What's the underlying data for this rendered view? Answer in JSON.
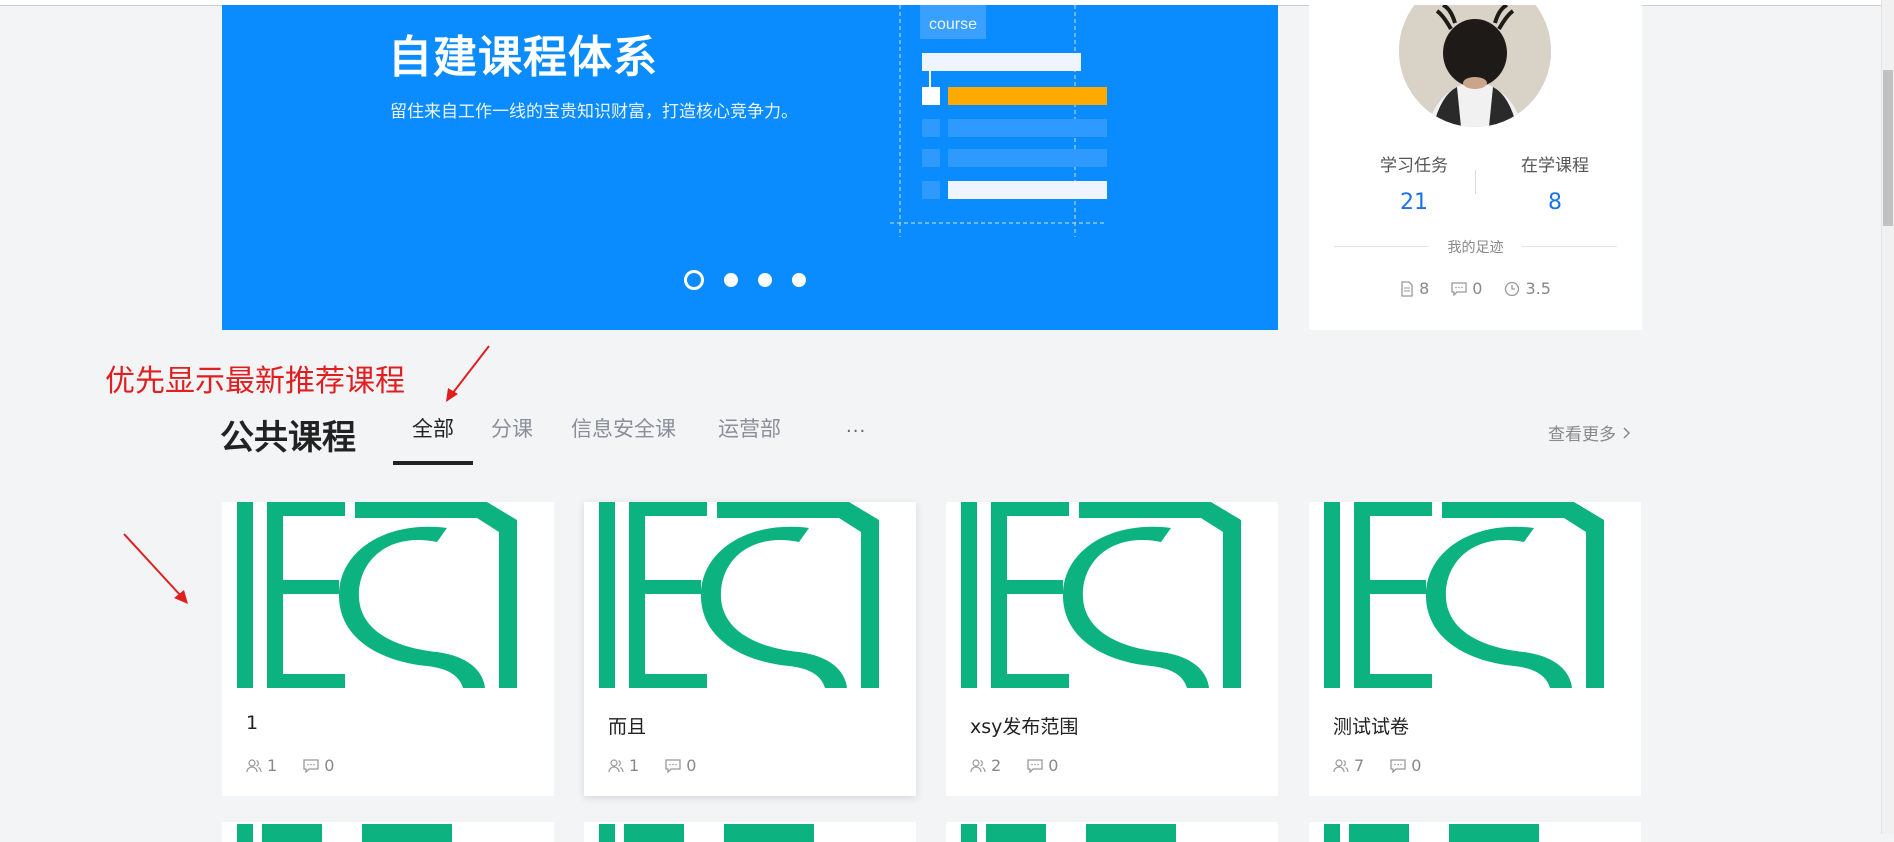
{
  "banner": {
    "title": "自建课程体系",
    "subtitle": "留住来自工作一线的宝贵知识财富，打造核心竞争力。",
    "illustration_tag": "course",
    "carousel_count": 4,
    "active_slide": 1
  },
  "profile": {
    "stats": [
      {
        "label": "学习任务",
        "value": "21"
      },
      {
        "label": "在学课程",
        "value": "8"
      }
    ],
    "footprint_label": "我的足迹",
    "footprint": {
      "docs": "8",
      "comments": "0",
      "hours": "3.5"
    }
  },
  "annotation": {
    "text": "优先显示最新推荐课程",
    "color": "#e02020"
  },
  "section": {
    "title": "公共课程",
    "tabs": [
      "全部",
      "分课",
      "信息安全课",
      "运营部"
    ],
    "active_tab": 0,
    "more": "···",
    "see_more": "查看更多"
  },
  "courses": [
    {
      "title": "1",
      "learners": "1",
      "comments": "0"
    },
    {
      "title": "而且",
      "learners": "1",
      "comments": "0"
    },
    {
      "title": "xsy发布范围",
      "learners": "2",
      "comments": "0"
    },
    {
      "title": "测试试卷",
      "learners": "7",
      "comments": "0"
    }
  ],
  "colors": {
    "brand": "#0a8cff",
    "logo_green": "#0cb381",
    "annotation_red": "#e02020",
    "link_blue": "#1a73e8"
  }
}
